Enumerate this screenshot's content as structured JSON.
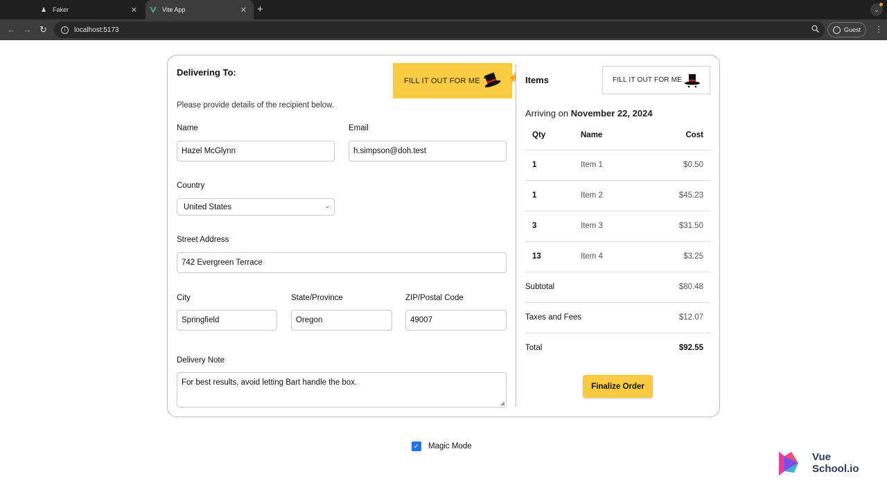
{
  "browser": {
    "tabs": [
      {
        "title": "Faker",
        "active": false
      },
      {
        "title": "Vite App",
        "active": true
      }
    ],
    "url": "localhost:5173",
    "profile": "Guest"
  },
  "delivery": {
    "heading": "Delivering To:",
    "fill_button": "FILL IT OUT FOR ME",
    "subtitle": "Please provide details of the recipient below.",
    "name_label": "Name",
    "name_value": "Hazel McGlynn",
    "email_label": "Email",
    "email_value": "h.simpson@doh.test",
    "country_label": "Country",
    "country_value": "United States",
    "street_label": "Street Address",
    "street_value": "742 Evergreen Terrace",
    "city_label": "City",
    "city_value": "Springfield",
    "state_label": "State/Province",
    "state_value": "Oregon",
    "zip_label": "ZIP/Postal Code",
    "zip_value": "49007",
    "note_label": "Delivery Note",
    "note_value": "For best results, avoid letting Bart handle the box."
  },
  "items": {
    "heading": "Items",
    "fill_button": "FILL IT OUT FOR ME",
    "arriving_prefix": "Arriving on",
    "arriving_date": "November 22, 2024",
    "columns": [
      "Qty",
      "Name",
      "Cost"
    ],
    "rows": [
      {
        "qty": "1",
        "name": "Item 1",
        "cost": "$0.50"
      },
      {
        "qty": "1",
        "name": "Item 2",
        "cost": "$45.23"
      },
      {
        "qty": "3",
        "name": "Item 3",
        "cost": "$31.50"
      },
      {
        "qty": "13",
        "name": "Item 4",
        "cost": "$3.25"
      }
    ],
    "subtotal_label": "Subtotal",
    "subtotal_value": "$80.48",
    "taxes_label": "Taxes and Fees",
    "taxes_value": "$12.07",
    "total_label": "Total",
    "total_value": "$92.55",
    "finalize_label": "Finalize Order"
  },
  "magic_mode": {
    "label": "Magic Mode",
    "checked": true
  },
  "watermark": {
    "line1": "Vue",
    "line2": "School.io"
  },
  "colors": {
    "accent_yellow": "#f8cb42",
    "checkbox_blue": "#1a73e8"
  }
}
